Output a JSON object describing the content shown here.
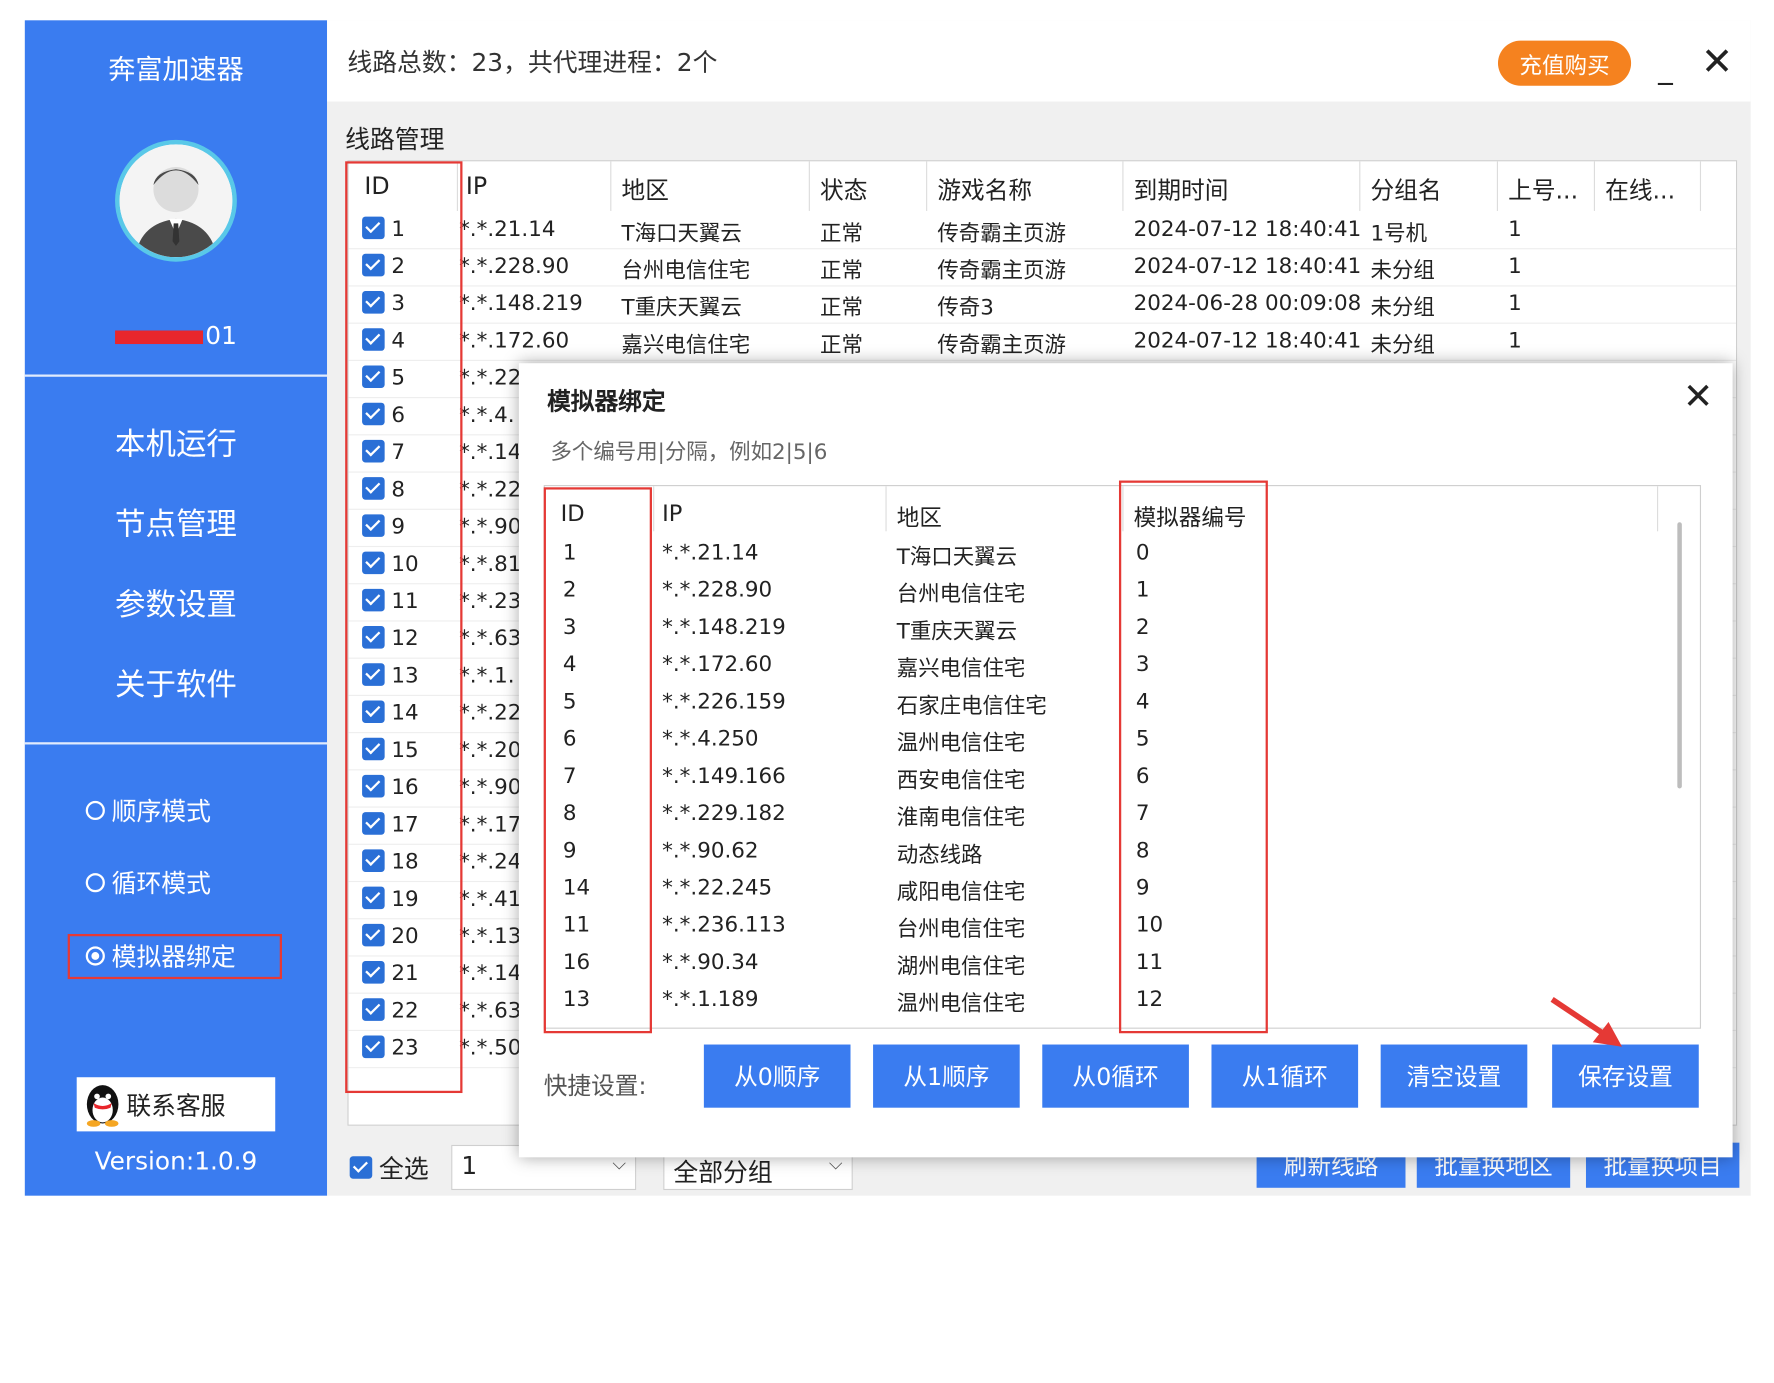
{
  "sidebar": {
    "app_title": "奔富加速器",
    "username_suffix": "01",
    "nav": [
      "本机运行",
      "节点管理",
      "参数设置",
      "关于软件"
    ],
    "modes": [
      {
        "label": "顺序模式",
        "selected": false
      },
      {
        "label": "循环模式",
        "selected": false
      },
      {
        "label": "模拟器绑定",
        "selected": true
      }
    ],
    "support_label": "联系客服",
    "version": "Version:1.0.9"
  },
  "topbar": {
    "summary": "线路总数：23，共代理进程：2个",
    "recharge_label": "充值购买",
    "minimize": "_",
    "close": "✕"
  },
  "section_title": "线路管理",
  "grid": {
    "headers": [
      "ID",
      "IP",
      "地区",
      "状态",
      "游戏名称",
      "到期时间",
      "分组名",
      "上号...",
      "在线..."
    ],
    "rows": [
      {
        "id": "1",
        "ip": "*.*.21.14",
        "region": "T海口天翼云",
        "status": "正常",
        "game": "传奇霸主页游",
        "expire": "2024-07-12 18:40:41",
        "group": "1号机",
        "login": "1"
      },
      {
        "id": "2",
        "ip": "*.*.228.90",
        "region": "台州电信住宅",
        "status": "正常",
        "game": "传奇霸主页游",
        "expire": "2024-07-12 18:40:41",
        "group": "未分组",
        "login": "1"
      },
      {
        "id": "3",
        "ip": "*.*.148.219",
        "region": "T重庆天翼云",
        "status": "正常",
        "game": "传奇3",
        "expire": "2024-06-28 00:09:08",
        "group": "未分组",
        "login": "1"
      },
      {
        "id": "4",
        "ip": "*.*.172.60",
        "region": "嘉兴电信住宅",
        "status": "正常",
        "game": "传奇霸主页游",
        "expire": "2024-07-12 18:40:41",
        "group": "未分组",
        "login": "1"
      },
      {
        "id": "5",
        "ip": "*.*.22"
      },
      {
        "id": "6",
        "ip": "*.*.4."
      },
      {
        "id": "7",
        "ip": "*.*.14"
      },
      {
        "id": "8",
        "ip": "*.*.22"
      },
      {
        "id": "9",
        "ip": "*.*.90"
      },
      {
        "id": "10",
        "ip": "*.*.81"
      },
      {
        "id": "11",
        "ip": "*.*.23"
      },
      {
        "id": "12",
        "ip": "*.*.63"
      },
      {
        "id": "13",
        "ip": "*.*.1."
      },
      {
        "id": "14",
        "ip": "*.*.22"
      },
      {
        "id": "15",
        "ip": "*.*.20"
      },
      {
        "id": "16",
        "ip": "*.*.90"
      },
      {
        "id": "17",
        "ip": "*.*.17"
      },
      {
        "id": "18",
        "ip": "*.*.24"
      },
      {
        "id": "19",
        "ip": "*.*.41"
      },
      {
        "id": "20",
        "ip": "*.*.13"
      },
      {
        "id": "21",
        "ip": "*.*.14"
      },
      {
        "id": "22",
        "ip": "*.*.63"
      },
      {
        "id": "23",
        "ip": "*.*.50"
      }
    ]
  },
  "bottom": {
    "select_all": "全选",
    "count_value": "1",
    "group_value": "全部分组",
    "buttons": [
      "刷新线路",
      "批量换地区",
      "批量换项目"
    ]
  },
  "dialog": {
    "title": "模拟器绑定",
    "close": "✕",
    "hint": "多个编号用|分隔，例如2|5|6",
    "headers": [
      "ID",
      "IP",
      "地区",
      "模拟器编号"
    ],
    "rows": [
      {
        "id": "1",
        "ip": "*.*.21.14",
        "region": "T海口天翼云",
        "emu": "0"
      },
      {
        "id": "2",
        "ip": "*.*.228.90",
        "region": "台州电信住宅",
        "emu": "1"
      },
      {
        "id": "3",
        "ip": "*.*.148.219",
        "region": "T重庆天翼云",
        "emu": "2"
      },
      {
        "id": "4",
        "ip": "*.*.172.60",
        "region": "嘉兴电信住宅",
        "emu": "3"
      },
      {
        "id": "5",
        "ip": "*.*.226.159",
        "region": "石家庄电信住宅",
        "emu": "4"
      },
      {
        "id": "6",
        "ip": "*.*.4.250",
        "region": "温州电信住宅",
        "emu": "5"
      },
      {
        "id": "7",
        "ip": "*.*.149.166",
        "region": "西安电信住宅",
        "emu": "6"
      },
      {
        "id": "8",
        "ip": "*.*.229.182",
        "region": "淮南电信住宅",
        "emu": "7"
      },
      {
        "id": "9",
        "ip": "*.*.90.62",
        "region": "动态线路",
        "emu": "8"
      },
      {
        "id": "14",
        "ip": "*.*.22.245",
        "region": "咸阳电信住宅",
        "emu": "9"
      },
      {
        "id": "11",
        "ip": "*.*.236.113",
        "region": "台州电信住宅",
        "emu": "10"
      },
      {
        "id": "16",
        "ip": "*.*.90.34",
        "region": "湖州电信住宅",
        "emu": "11"
      },
      {
        "id": "13",
        "ip": "*.*.1.189",
        "region": "温州电信住宅",
        "emu": "12"
      }
    ],
    "quick_label": "快捷设置:",
    "quick_buttons": [
      "从0顺序",
      "从1顺序",
      "从0循环",
      "从1循环",
      "清空设置",
      "保存设置"
    ]
  },
  "colors": {
    "sidebar": "#3a7cf0",
    "accent_orange": "#f5821f",
    "highlight_red": "#e53935",
    "checkbox": "#2a6fd6"
  },
  "icons": [
    "user-avatar-icon",
    "qq-penguin-icon",
    "radio-icon",
    "checkbox-icon",
    "chevron-down-icon",
    "close-icon",
    "red-arrow-icon"
  ]
}
